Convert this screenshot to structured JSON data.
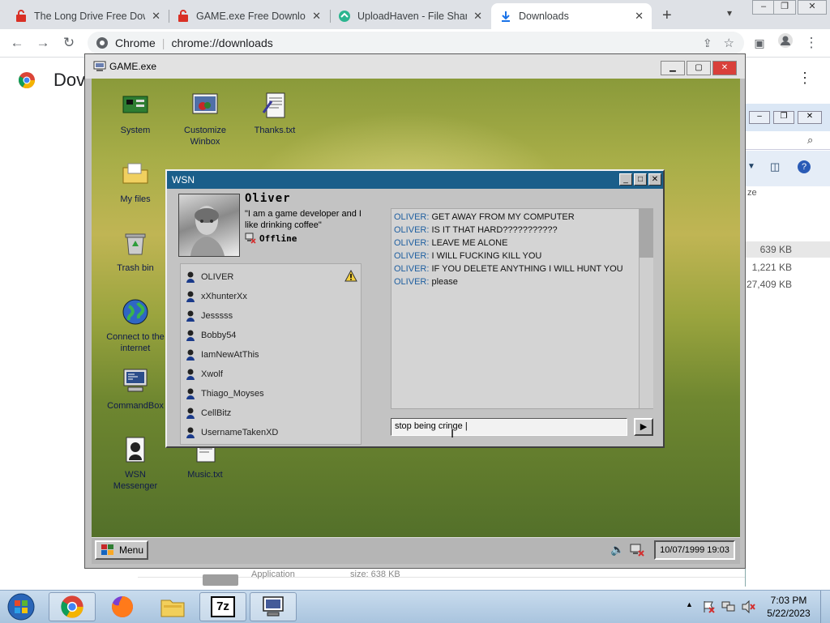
{
  "chrome": {
    "tabs": [
      {
        "title": "The Long Drive Free Dow",
        "active": false
      },
      {
        "title": "GAME.exe Free Download",
        "active": false
      },
      {
        "title": "UploadHaven - File Sharin",
        "active": false
      },
      {
        "title": "Downloads",
        "active": true
      }
    ],
    "new_tab_glyph": "+",
    "omnibox": {
      "site": "Chrome",
      "url": "chrome://downloads"
    },
    "page_title_partial": "Dov"
  },
  "game_window": {
    "title": "GAME.exe",
    "desktop_icons": [
      {
        "label": "System",
        "icon": "motherboard-icon"
      },
      {
        "label": "Customize Winbox",
        "icon": "customize-icon"
      },
      {
        "label": "Thanks.txt",
        "icon": "text-file-icon"
      },
      {
        "label": "My files",
        "icon": "folder-icon"
      },
      {
        "label": "Trash bin",
        "icon": "trash-icon"
      },
      {
        "label": "Connect to the internet",
        "icon": "globe-icon"
      },
      {
        "label": "CommandBox",
        "icon": "terminal-icon"
      },
      {
        "label": "WSN Messenger",
        "icon": "messenger-icon"
      },
      {
        "label": "Music.txt",
        "icon": "text-file-icon"
      }
    ],
    "taskbar": {
      "menu_label": "Menu",
      "clock": "10/07/1999  19:03"
    }
  },
  "wsn": {
    "title": "WSN",
    "profile": {
      "name": "Oliver",
      "quote": "\"I am a game developer and I like drinking coffee\"",
      "status": "Offline"
    },
    "contacts": [
      "OLIVER",
      "xXhunterXx",
      "Jesssss",
      "Bobby54",
      "IamNewAtThis",
      "Xwolf",
      "Thiago_Moyses",
      "CellBitz",
      "UsernameTakenXD"
    ],
    "messages": [
      {
        "sender": "OLIVER:",
        "text": "GET AWAY FROM MY COMPUTER"
      },
      {
        "sender": "OLIVER:",
        "text": "IS IT THAT HARD???????????"
      },
      {
        "sender": "OLIVER:",
        "text": "LEAVE ME ALONE"
      },
      {
        "sender": "OLIVER:",
        "text": "I WILL FUCKING KILL YOU"
      },
      {
        "sender": "OLIVER:",
        "text": "IF YOU DELETE ANYTHING I WILL HUNT YOU"
      },
      {
        "sender": "OLIVER:",
        "text": "please"
      }
    ],
    "input_value": "stop being cringe |",
    "send_glyph": "▶"
  },
  "explorer_bg": {
    "size_header": "ze",
    "sizes": [
      "639 KB",
      "1,221 KB",
      "27,409 KB"
    ]
  },
  "download_item_partial": {
    "type": "Application",
    "size": "size: 638 KB"
  },
  "win_taskbar": {
    "time": "7:03 PM",
    "date": "5/22/2023",
    "sevenzip_label": "7z"
  }
}
